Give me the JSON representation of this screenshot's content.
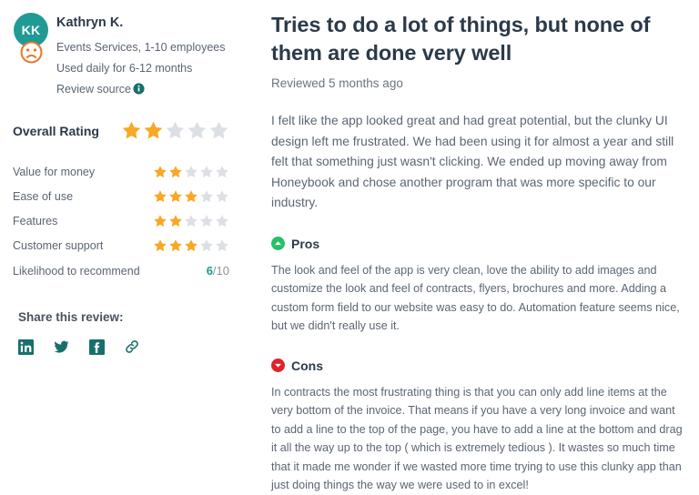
{
  "reviewer": {
    "initials": "KK",
    "name": "Kathryn K.",
    "industry_line": "Events Services, 1-10 employees",
    "usage_line": "Used daily for 6-12 months",
    "review_source_label": "Review source",
    "sentiment_icon": "sad-face-icon",
    "info_icon": "info-icon"
  },
  "ratings": {
    "overall_label": "Overall Rating",
    "overall_value": 2,
    "max_stars": 5,
    "rows": [
      {
        "label": "Value for money",
        "value": 2
      },
      {
        "label": "Ease of use",
        "value": 3
      },
      {
        "label": "Features",
        "value": 2
      },
      {
        "label": "Customer support",
        "value": 3
      }
    ],
    "likelihood": {
      "label": "Likelihood to recommend",
      "score": "6",
      "out_of": "/10"
    }
  },
  "share": {
    "title": "Share this review:",
    "icons": [
      {
        "name": "linkedin-icon",
        "label": "LinkedIn"
      },
      {
        "name": "twitter-icon",
        "label": "Twitter"
      },
      {
        "name": "facebook-icon",
        "label": "Facebook"
      },
      {
        "name": "link-icon",
        "label": "Copy link"
      }
    ]
  },
  "review": {
    "title": "Tries to do a lot of things, but none of them are done very well",
    "reviewed_when": "Reviewed 5 months ago",
    "body": "I felt like the app looked great and had great potential, but the clunky UI design left me frustrated. We had been using it for almost a year and still felt that something just wasn't clicking. We ended up moving away from Honeybook and chose another program that was more specific to our industry.",
    "pros": {
      "heading": "Pros",
      "icon": "circle-chevron-up-icon",
      "text": "The look and feel of the app is very clean, love the ability to add images and customize the look and feel of contracts, flyers, brochures and more. Adding a custom form field to our website was easy to do. Automation feature seems nice, but we didn't really use it."
    },
    "cons": {
      "heading": "Cons",
      "icon": "circle-chevron-down-icon",
      "text": "In contracts the most frustrating thing is that you can only add line items at the very bottom of the invoice. That means if you have a very long invoice and want to add a line to the top of the page, you have to add a line at the bottom and drag it all the way up to the top ( which is extremely tedious ). It wastes so much time that it made me wonder if we wasted more time trying to use this clunky app than just doing things the way we were used to in excel!"
    }
  },
  "colors": {
    "brand_teal": "#179b8e",
    "star_filled": "#f9a825",
    "star_empty": "#dcdfe3",
    "pros_green": "#26c06a",
    "cons_red": "#e0242b",
    "sentiment_orange": "#e8772e",
    "heading_dark": "#2b3a4a",
    "body_gray": "#5b6573"
  }
}
